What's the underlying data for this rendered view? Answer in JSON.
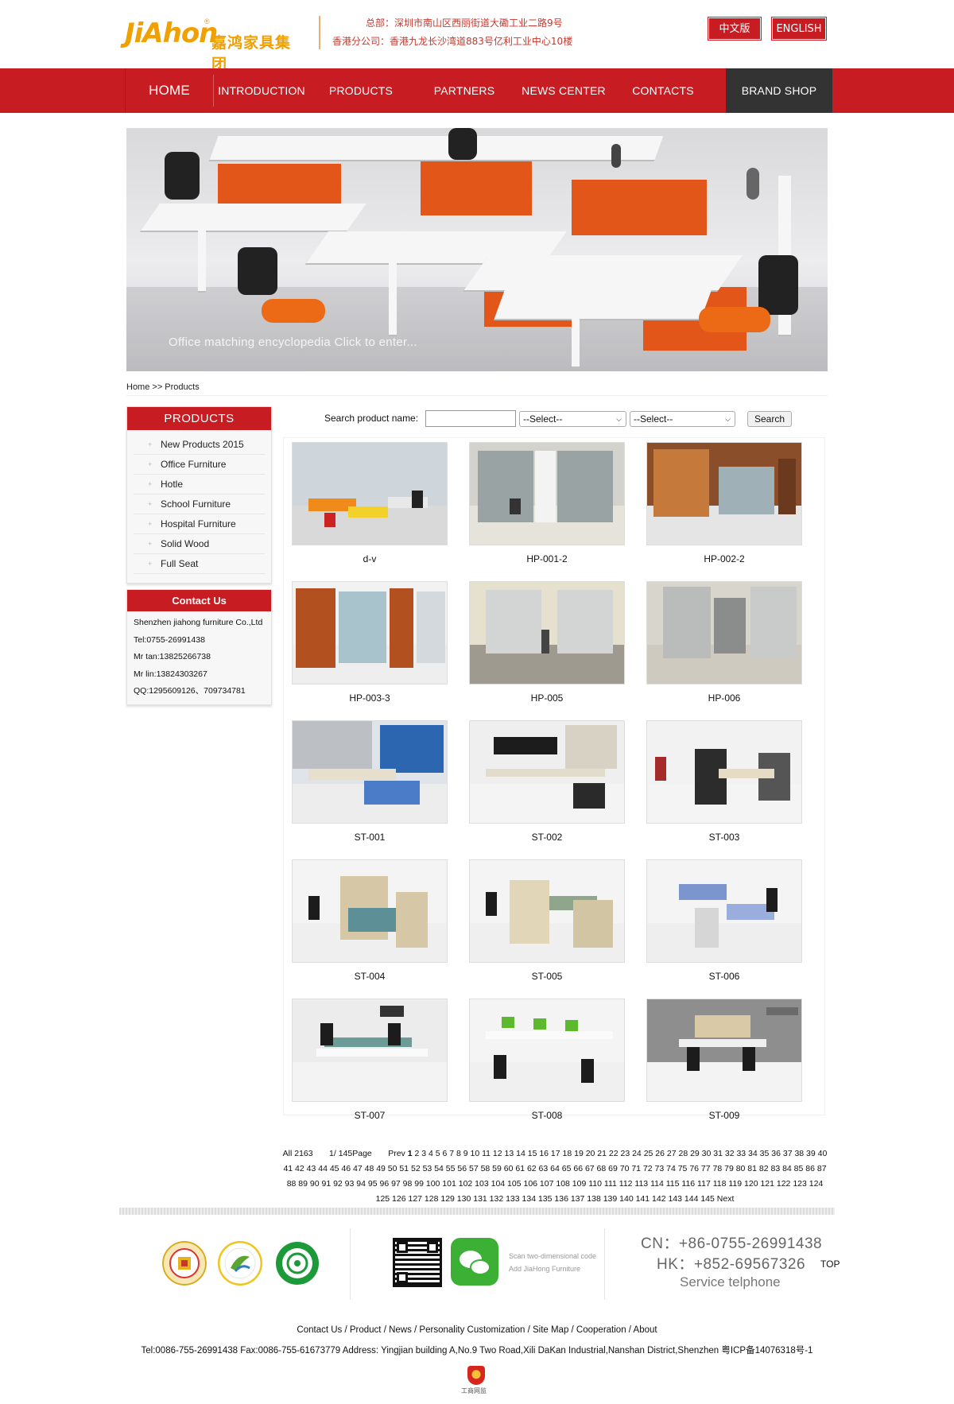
{
  "header": {
    "logo_text": "JiAhon",
    "logo_cn": "嘉鸿家具集团",
    "hq_label": "总部：",
    "hq_address": "深圳市南山区西丽街道大磡工业二路9号",
    "hk_label": "香港分公司：",
    "hk_address": "香港九龙长沙湾道883号亿利工业中心10楼",
    "lang_cn": "中文版",
    "lang_en": "ENGLISH"
  },
  "nav": {
    "items": [
      "HOME",
      "INTRODUCTION",
      "PRODUCTS",
      "PARTNERS",
      "NEWS CENTER",
      "CONTACTS",
      "BRAND SHOP"
    ]
  },
  "banner": {
    "caption": "Office matching encyclopedia Click to enter..."
  },
  "breadcrumb": "Home >> Products",
  "sidebar": {
    "products_title": "PRODUCTS",
    "categories": [
      "New Products 2015",
      "Office Furniture",
      "Hotle",
      "School Furniture",
      "Hospital Furniture",
      "Solid Wood",
      "Full Seat"
    ],
    "contact_title": "Contact Us",
    "contact_lines": [
      "Shenzhen jiahong furniture Co.,Ltd",
      "Tel:0755-26991438",
      "Mr tan:13825266738",
      "Mr lin:13824303267",
      "QQ:1295609126、709734781"
    ]
  },
  "search": {
    "label": "Search product name:",
    "input_value": "",
    "select1": "--Select--",
    "select2": "--Select--",
    "button": "Search"
  },
  "products": [
    {
      "name": "d-v",
      "theme": "orange-tables"
    },
    {
      "name": "HP-001-2",
      "theme": "glass-office"
    },
    {
      "name": "HP-002-2",
      "theme": "wood-partition"
    },
    {
      "name": "HP-003-3",
      "theme": "wood-glass-wall"
    },
    {
      "name": "HP-005",
      "theme": "glass-corridor"
    },
    {
      "name": "HP-006",
      "theme": "glass-room"
    },
    {
      "name": "ST-001",
      "theme": "blue-desk"
    },
    {
      "name": "ST-002",
      "theme": "black-desk"
    },
    {
      "name": "ST-003",
      "theme": "workstation-grey"
    },
    {
      "name": "ST-004",
      "theme": "workstation-teal"
    },
    {
      "name": "ST-005",
      "theme": "workstation-beige"
    },
    {
      "name": "ST-006",
      "theme": "workstation-blue"
    },
    {
      "name": "ST-007",
      "theme": "bench-teal"
    },
    {
      "name": "ST-008",
      "theme": "bench-green"
    },
    {
      "name": "ST-009",
      "theme": "bench-beige"
    }
  ],
  "pagination": {
    "total": "All 2163",
    "page_info": "1/ 145Page",
    "prev": "Prev",
    "current": "1",
    "pages_after_current": "2 3 4 5 6 7 8 9 10 11 12 13 14 15 16 17 18 19 20 21 22 23 24 25 26 27 28 29 30 31 32 33 34 35 36 37 38 39 40 41 42 43 44 45 46 47 48 49 50 51 52 53 54 55 56 57 58 59 60 61 62 63 64 65 66 67 68 69 70 71 72 73 74 75 76 77 78 79 80 81 82 83 84 85 86 87 88 89 90 91 92 93 94 95 96 97 98 99 100 101 102 103 104 105 106 107 108 109 110 111 112 113 114 115 116 117 118 119 120 121 122 123 124 125 126 127 128 129 130 131 132 133 134 135 136 137 138 139 140 141 142 143 144 145",
    "next": "Next"
  },
  "footer": {
    "scan_line1": "Scan two-dimensional code",
    "scan_line2": "Add JiaHong Furniture",
    "tel_cn": "CN：+86-0755-26991438",
    "tel_hk": "HK：+852-69567326",
    "tel_label": "Service telphone",
    "top": "TOP",
    "links": "Contact Us / Product / News / Personality Customization / Site Map / Cooperation / About",
    "address": "Tel:0086-755-26991438 Fax:0086-755-61673779 Address: Yingjian building A,No.9 Two Road,Xili DaKan Industrial,Nanshan District,Shenzhen 粤ICP备14076318号-1",
    "police_label": "工商网监"
  },
  "colors": {
    "brand_red": "#c71c22",
    "logo_orange": "#f0a000",
    "brand_shop_bg": "#333333"
  }
}
